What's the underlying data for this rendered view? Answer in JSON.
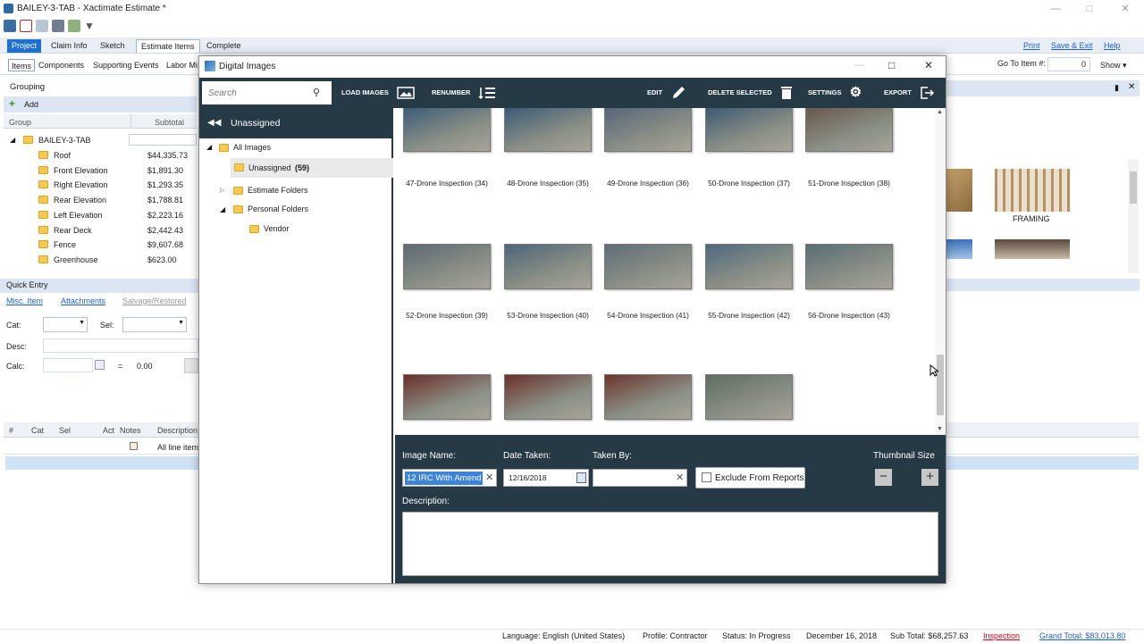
{
  "window": {
    "title": "BAILEY-3-TAB - Xactimate Estimate *"
  },
  "main_tabs": [
    {
      "label": "Project"
    },
    {
      "label": "Claim Info"
    },
    {
      "label": "Sketch"
    },
    {
      "label": "Estimate Items"
    },
    {
      "label": "Complete"
    }
  ],
  "top_links": {
    "print": "Print",
    "save_exit": "Save & Exit",
    "help": "Help"
  },
  "sub_tabs": [
    {
      "label": "Items"
    },
    {
      "label": "Components"
    },
    {
      "label": "Supporting Events"
    },
    {
      "label": "Labor Mi"
    }
  ],
  "goto": {
    "label": "Go To Item #:",
    "value": "0",
    "show": "Show"
  },
  "grouping": {
    "title": "Grouping",
    "add_label": "Add",
    "col_group": "Group",
    "col_subtotal": "Subtotal",
    "root": "BAILEY-3-TAB",
    "rows": [
      {
        "name": "Roof",
        "subtotal": "$44,335.73"
      },
      {
        "name": "Front Elevation",
        "subtotal": "$1,891.30"
      },
      {
        "name": "Right Elevation",
        "subtotal": "$1,293.35"
      },
      {
        "name": "Rear Elevation",
        "subtotal": "$1,788.81"
      },
      {
        "name": "Left Elevation",
        "subtotal": "$2,223.16"
      },
      {
        "name": "Rear Deck",
        "subtotal": "$2,442.43"
      },
      {
        "name": "Fence",
        "subtotal": "$9,607.68"
      },
      {
        "name": "Greenhouse",
        "subtotal": "$623.00"
      }
    ]
  },
  "quick_entry": {
    "title": "Quick Entry",
    "misc_item": "Misc. Item",
    "attachments": "Attachments",
    "salvage": "Salvage/Restored",
    "cat_label": "Cat:",
    "sel_label": "Sel:",
    "desc_label": "Desc:",
    "calc_label": "Calc:",
    "equals": "=",
    "calc_value": "0.00"
  },
  "line_grid": {
    "headers": [
      "#",
      "Cat",
      "Sel",
      "Act",
      "Notes",
      "Description"
    ],
    "first_row_desc": "All line item"
  },
  "right_thumbs": {
    "framing_label": "FRAMING"
  },
  "dialog": {
    "title": "Digital Images",
    "search_placeholder": "Search",
    "toolbar": {
      "load_images": "LOAD IMAGES",
      "renumber": "RENUMBER",
      "edit": "EDIT",
      "delete_selected": "DELETE SELECTED",
      "settings": "SETTINGS",
      "export": "EXPORT"
    },
    "tree": {
      "header": "Unassigned",
      "all_images": "All Images",
      "unassigned": "Unassigned",
      "unassigned_count": "(59)",
      "estimate_folders": "Estimate Folders",
      "personal_folders": "Personal Folders",
      "vendor": "Vendor"
    },
    "images": [
      {
        "caption": "47-Drone Inspection (34)",
        "tone": "#3d5d78"
      },
      {
        "caption": "48-Drone Inspection (35)",
        "tone": "#3a5a76"
      },
      {
        "caption": "49-Drone Inspection (36)",
        "tone": "#56667a"
      },
      {
        "caption": "50-Drone Inspection (37)",
        "tone": "#3d5a73"
      },
      {
        "caption": "51-Drone Inspection (38)",
        "tone": "#6a584d"
      },
      {
        "caption": "52-Drone Inspection (39)",
        "tone": "#5d6a72"
      },
      {
        "caption": "53-Drone Inspection (40)",
        "tone": "#4c6679"
      },
      {
        "caption": "54-Drone Inspection (41)",
        "tone": "#5e6e78"
      },
      {
        "caption": "55-Drone Inspection (42)",
        "tone": "#4e6a7e"
      },
      {
        "caption": "56-Drone Inspection (43)",
        "tone": "#5a6d76"
      },
      {
        "caption": "",
        "tone": "#6b2f26"
      },
      {
        "caption": "",
        "tone": "#6a3027"
      },
      {
        "caption": "",
        "tone": "#6d352b"
      },
      {
        "caption": "",
        "tone": "#5f6e60"
      }
    ],
    "details": {
      "image_name_label": "Image Name:",
      "image_name_value": "12 IRC With Amend",
      "date_taken_label": "Date Taken:",
      "date_taken_value": "12/16/2018",
      "taken_by_label": "Taken By:",
      "taken_by_value": "",
      "exclude_label": "Exclude From Reports",
      "thumbnail_size_label": "Thumbnail Size",
      "minus": "−",
      "plus": "+",
      "description_label": "Description:",
      "description_value": ""
    }
  },
  "status": {
    "language": "Language:  English (United States)",
    "profile": "Profile:  Contractor",
    "status": "Status:  In Progress",
    "date": "December 16, 2018",
    "subtotal": "Sub Total: $68,257.63",
    "inspection": "Inspection",
    "grand_total": "Grand Total: $83,013.80"
  },
  "colors": {
    "dark_bar": "#263a45",
    "tab_blue": "#1d6fd2",
    "link_blue": "#1f5fc9",
    "link_red": "#d0021b"
  }
}
